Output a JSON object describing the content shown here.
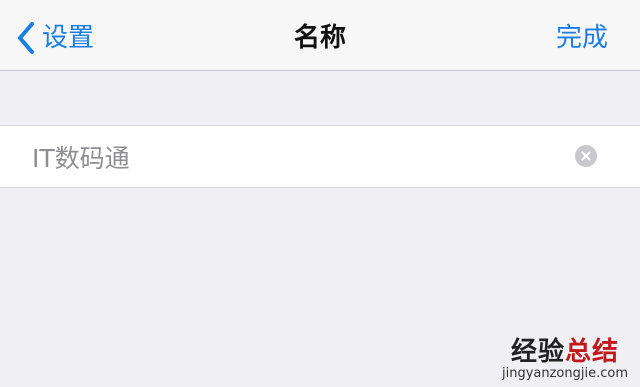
{
  "nav": {
    "back_label": "设置",
    "title": "名称",
    "done_label": "完成"
  },
  "name_field": {
    "value": "IT数码通"
  },
  "icons": {
    "back": "chevron-left-icon",
    "clear": "clear-circle-x-icon"
  },
  "colors": {
    "accent": "#1a7ee6",
    "background": "#efeff4",
    "watermark_accent": "#c0181b"
  },
  "watermark": {
    "part1": "经验",
    "part2": "总结",
    "url": "jingyanzongjie.com"
  }
}
